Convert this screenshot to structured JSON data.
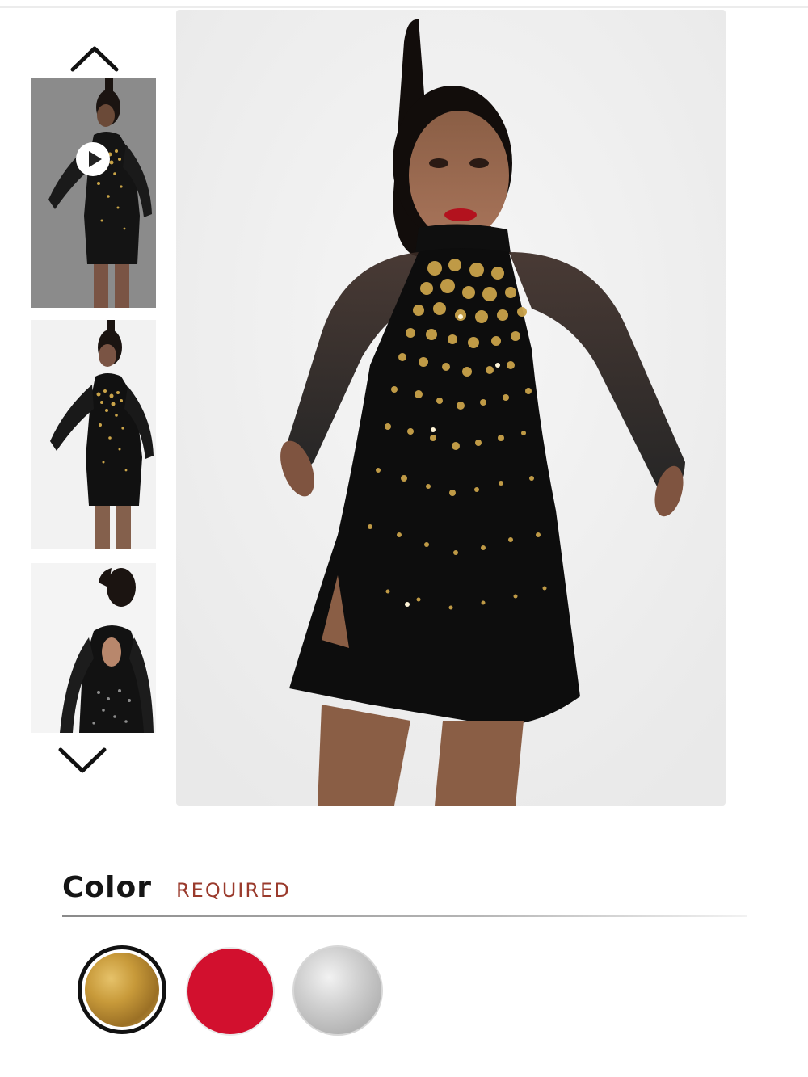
{
  "gallery": {
    "scroll_up_icon": "chevron-up-icon",
    "scroll_down_icon": "chevron-down-icon",
    "thumbnails": [
      {
        "view": "front",
        "has_video": true
      },
      {
        "view": "front"
      },
      {
        "view": "back"
      }
    ],
    "main_image_view": "front"
  },
  "color_selector": {
    "label": "Color",
    "required_text": "REQUIRED",
    "required_color": "#9a3a2c",
    "swatches": [
      {
        "selected": true,
        "color": "#c89a3a"
      },
      {
        "selected": false,
        "color": "#d2102e"
      },
      {
        "selected": false,
        "color": "#c8c8c8"
      }
    ]
  }
}
